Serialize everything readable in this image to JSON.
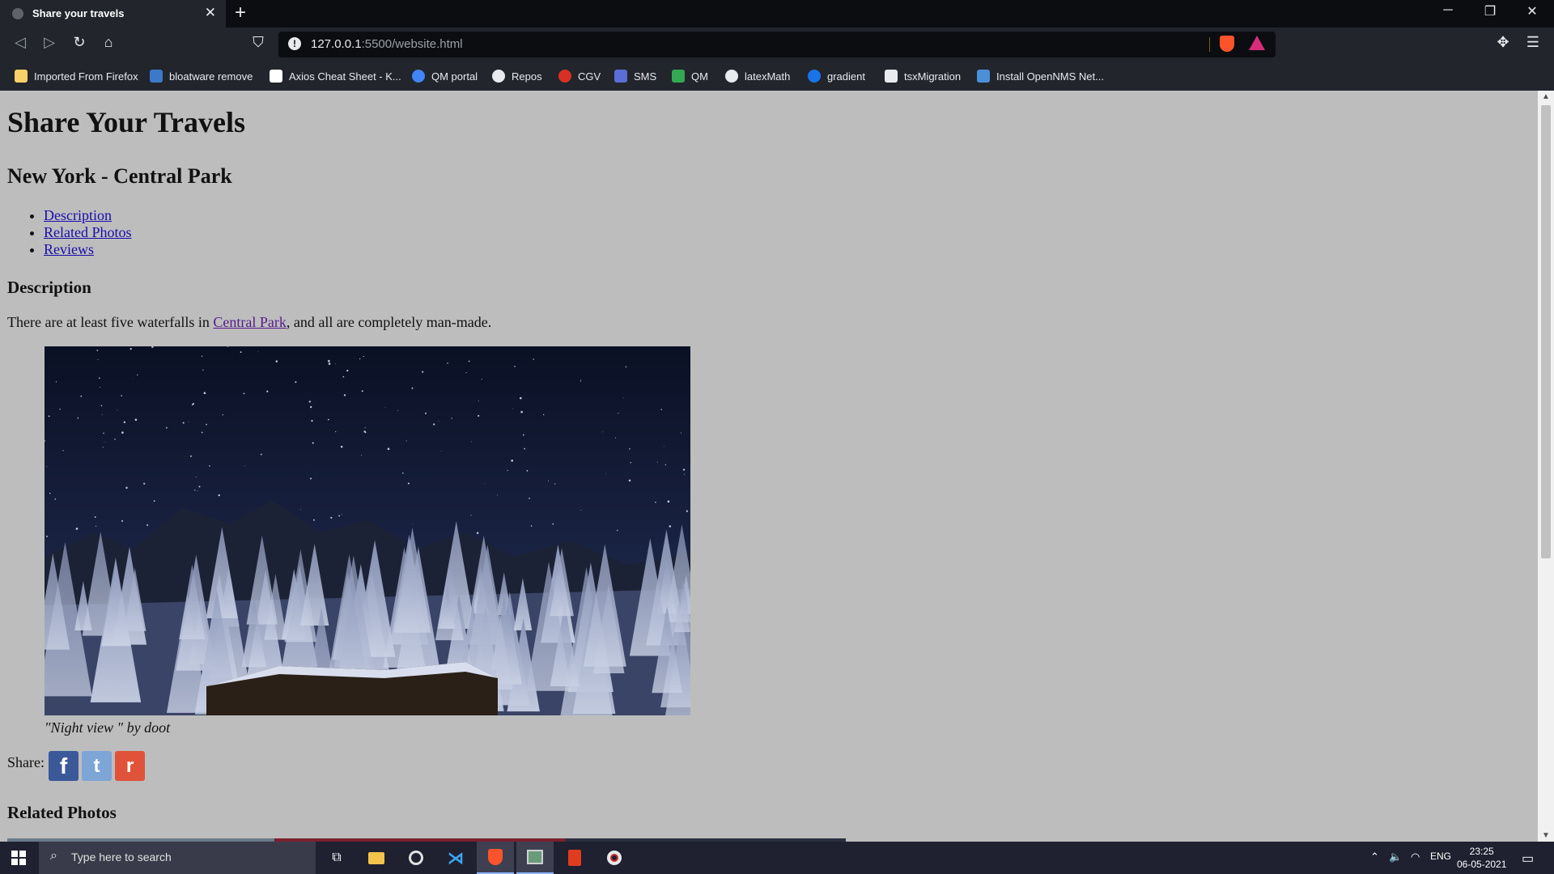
{
  "browser": {
    "tab_title": "Share your travels",
    "tab_close": "✕",
    "new_tab": "+",
    "url_host": "127.0.0.1",
    "url_path": ":5500/website.html",
    "window_controls": [
      "─",
      "❐",
      "✕"
    ]
  },
  "bookmarks": [
    {
      "label": "Imported From Firefox",
      "icon": "folder-icon",
      "color": "#f7d26a"
    },
    {
      "label": "bloatware remove",
      "icon": "dw-icon",
      "color": "#3c79c8"
    },
    {
      "label": "Axios Cheat Sheet - K...",
      "icon": "k-icon",
      "color": "#ffffff"
    },
    {
      "label": "QM portal",
      "icon": "qm-portal-icon",
      "color": "#4285f4"
    },
    {
      "label": "Repos",
      "icon": "github-icon",
      "color": "#e8eaed"
    },
    {
      "label": "CGV",
      "icon": "cgv-icon",
      "color": "#d93025"
    },
    {
      "label": "SMS",
      "icon": "sms-icon",
      "color": "#5b6ed6"
    },
    {
      "label": "QM",
      "icon": "drive-icon",
      "color": "#34a853"
    },
    {
      "label": "latexMath",
      "icon": "github-icon",
      "color": "#e8eaed"
    },
    {
      "label": "gradient",
      "icon": "gradient-icon",
      "color": "#1a73e8"
    },
    {
      "label": "tsxMigration",
      "icon": "tsx-icon",
      "color": "#e8eaed"
    },
    {
      "label": "Install OpenNMS Net...",
      "icon": "opennms-icon",
      "color": "#4a90d9"
    }
  ],
  "page": {
    "title": "Share Your Travels",
    "subtitle": "New York - Central Park",
    "nav": [
      "Description",
      "Related Photos",
      "Reviews"
    ],
    "description_heading": "Description",
    "description_before": "There are at least five waterfalls in ",
    "description_link": "Central Park",
    "description_after": ", and all are completely man-made.",
    "caption": "\"Night view \" by doot",
    "share_label": "Share:",
    "share_icons": [
      {
        "name": "facebook",
        "glyph": "f",
        "color": "#3b5998"
      },
      {
        "name": "twitter",
        "glyph": "t",
        "color": "#55acee"
      },
      {
        "name": "reddit",
        "glyph": "r",
        "color": "#ff4500"
      }
    ],
    "related_heading": "Related Photos"
  },
  "taskbar": {
    "search_placeholder": "Type here to search",
    "language": "ENG",
    "time": "23:25",
    "date": "06-05-2021"
  }
}
